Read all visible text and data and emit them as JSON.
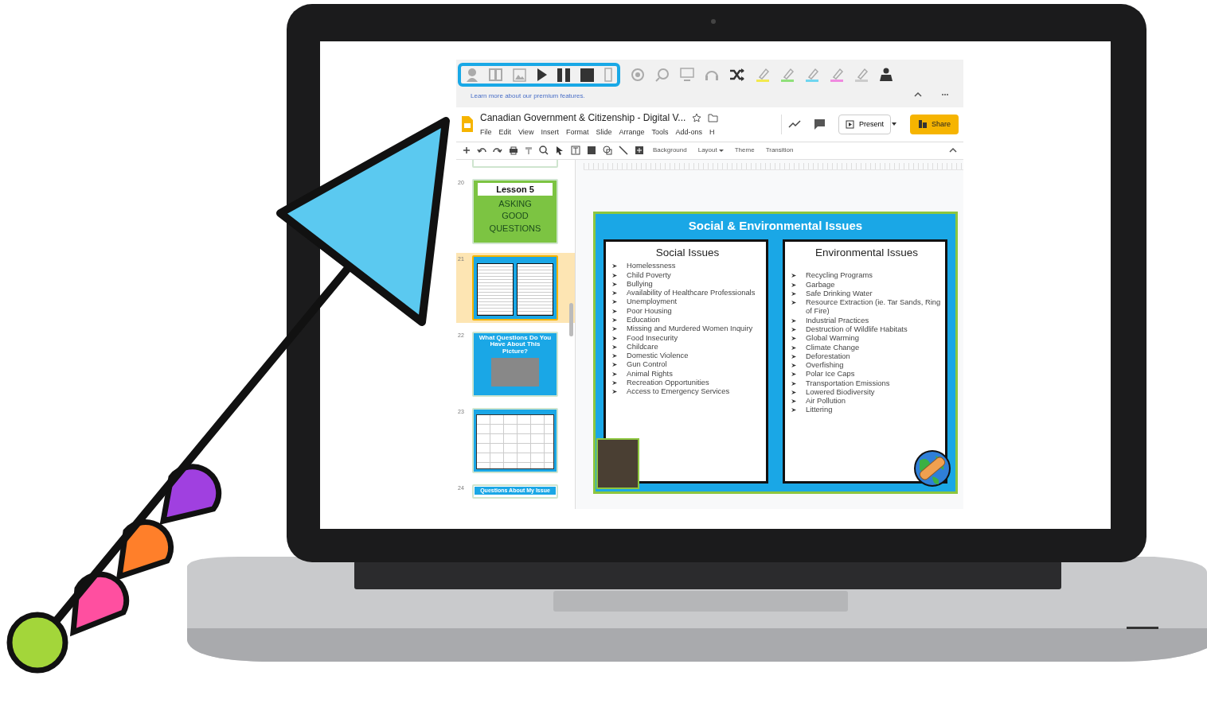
{
  "extension_toolbar": {
    "link": "Learn more about our premium features."
  },
  "document": {
    "title": "Canadian Government & Citizenship - Digital V...",
    "menu": [
      "File",
      "Edit",
      "View",
      "Insert",
      "Format",
      "Slide",
      "Arrange",
      "Tools",
      "Add-ons",
      "H"
    ],
    "present": "Present",
    "share": "Share"
  },
  "toolbar": {
    "buttons": [
      {
        "label": "Background",
        "kind": "plain"
      },
      {
        "label": "Layout",
        "kind": "dropdown"
      },
      {
        "label": "Theme",
        "kind": "plain"
      },
      {
        "label": "Transition",
        "kind": "plain"
      }
    ]
  },
  "filmstrip": [
    {
      "kind": "document",
      "selected": false
    },
    {
      "number": "20",
      "kind": "title",
      "title": "Lesson 5",
      "subtitle": "ASKING GOOD QUESTIONS",
      "selected": false
    },
    {
      "number": "21",
      "kind": "issues",
      "selected": true
    },
    {
      "number": "22",
      "kind": "picture",
      "title": "What Questions Do You Have About This Picture?",
      "selected": false
    },
    {
      "number": "23",
      "kind": "table",
      "selected": false
    },
    {
      "number": "24",
      "kind": "banner",
      "title": "Questions About My Issue",
      "selected": false
    }
  ],
  "slide": {
    "title": "Social & Environmental Issues",
    "columns": [
      {
        "heading": "Social Issues",
        "kind": "photo",
        "items": [
          "Homelessness",
          "Child Poverty",
          "Bullying",
          "Availability of Healthcare Professionals",
          "Unemployment",
          "Poor Housing",
          "Education",
          "Missing and Murdered Women Inquiry",
          "Food Insecurity",
          "Childcare",
          "Domestic Violence",
          "Gun Control",
          "Animal Rights",
          "Recreation Opportunities",
          "Access to Emergency Services"
        ]
      },
      {
        "heading": "Environmental Issues",
        "kind": "globe",
        "items": [
          "Recycling Programs",
          "Garbage",
          "Safe Drinking Water",
          "Resource Extraction (ie. Tar Sands, Ring of Fire)",
          "Industrial Practices",
          "Destruction of Wildlife Habitats",
          "Global Warming",
          "Climate Change",
          "Deforestation",
          "Overfishing",
          "Polar Ice Caps",
          "Transportation Emissions",
          "Lowered Biodiversity",
          "Air Pollution",
          "Littering"
        ]
      }
    ]
  }
}
